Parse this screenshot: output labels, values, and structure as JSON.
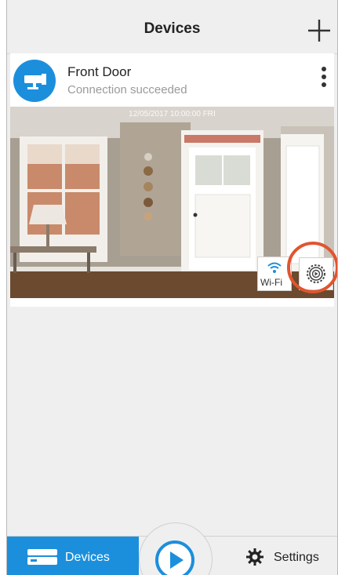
{
  "header": {
    "title": "Devices",
    "add_icon": "plus-icon"
  },
  "device": {
    "name": "Front Door",
    "status": "Connection succeeded",
    "icon": "camera-icon",
    "menu_icon": "more-vertical-icon",
    "timestamp": "12/05/2017 10:00:00 FRI",
    "wifi_label": "Wi-Fi",
    "settings_icon": "gear-icon"
  },
  "tabs": {
    "devices_label": "Devices",
    "settings_label": "Settings",
    "play_icon": "play-icon"
  },
  "colors": {
    "accent": "#1c8fdc",
    "highlight": "#e0552f",
    "background": "#efeff0"
  }
}
